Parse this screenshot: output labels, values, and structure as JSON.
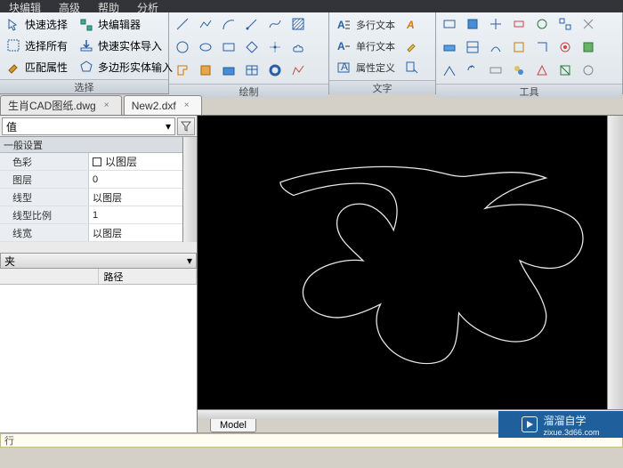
{
  "menus": [
    "块编辑",
    "高级",
    "帮助",
    "分析"
  ],
  "ribbon": {
    "select": {
      "label": "选择",
      "items": [
        {
          "icon": "cursor",
          "text": "快速选择"
        },
        {
          "icon": "select-all",
          "text": "选择所有"
        },
        {
          "icon": "match",
          "text": "匹配属性"
        }
      ],
      "items2": [
        {
          "icon": "block",
          "text": "块编辑器"
        },
        {
          "icon": "import",
          "text": "快速实体导入"
        },
        {
          "icon": "polygon",
          "text": "多边形实体输入"
        }
      ]
    },
    "draw": {
      "label": "绘制"
    },
    "text": {
      "label": "文字",
      "rows": [
        {
          "icon": "mtext",
          "text": "多行文本"
        },
        {
          "icon": "stext",
          "text": "单行文本"
        },
        {
          "icon": "attr",
          "text": "属性定义"
        }
      ]
    },
    "tools": {
      "label": "工具"
    }
  },
  "tabs": [
    {
      "name": "生肖CAD图纸.dwg",
      "active": false
    },
    {
      "name": "New2.dxf",
      "active": true
    }
  ],
  "prop": {
    "selector": "值",
    "section": "一般设置",
    "rows": [
      {
        "k": "色彩",
        "v": "以图层",
        "swatch": true
      },
      {
        "k": "图层",
        "v": "0"
      },
      {
        "k": "线型",
        "v": "以图层"
      },
      {
        "k": "线型比例",
        "v": "1"
      },
      {
        "k": "线宽",
        "v": "以图层"
      }
    ]
  },
  "folder": {
    "header": "夹",
    "cols": [
      "",
      "路径"
    ]
  },
  "modeltab": "Model",
  "cmd": "行",
  "watermark": {
    "title": "溜溜自学",
    "site": "zixue.3d66.com"
  }
}
